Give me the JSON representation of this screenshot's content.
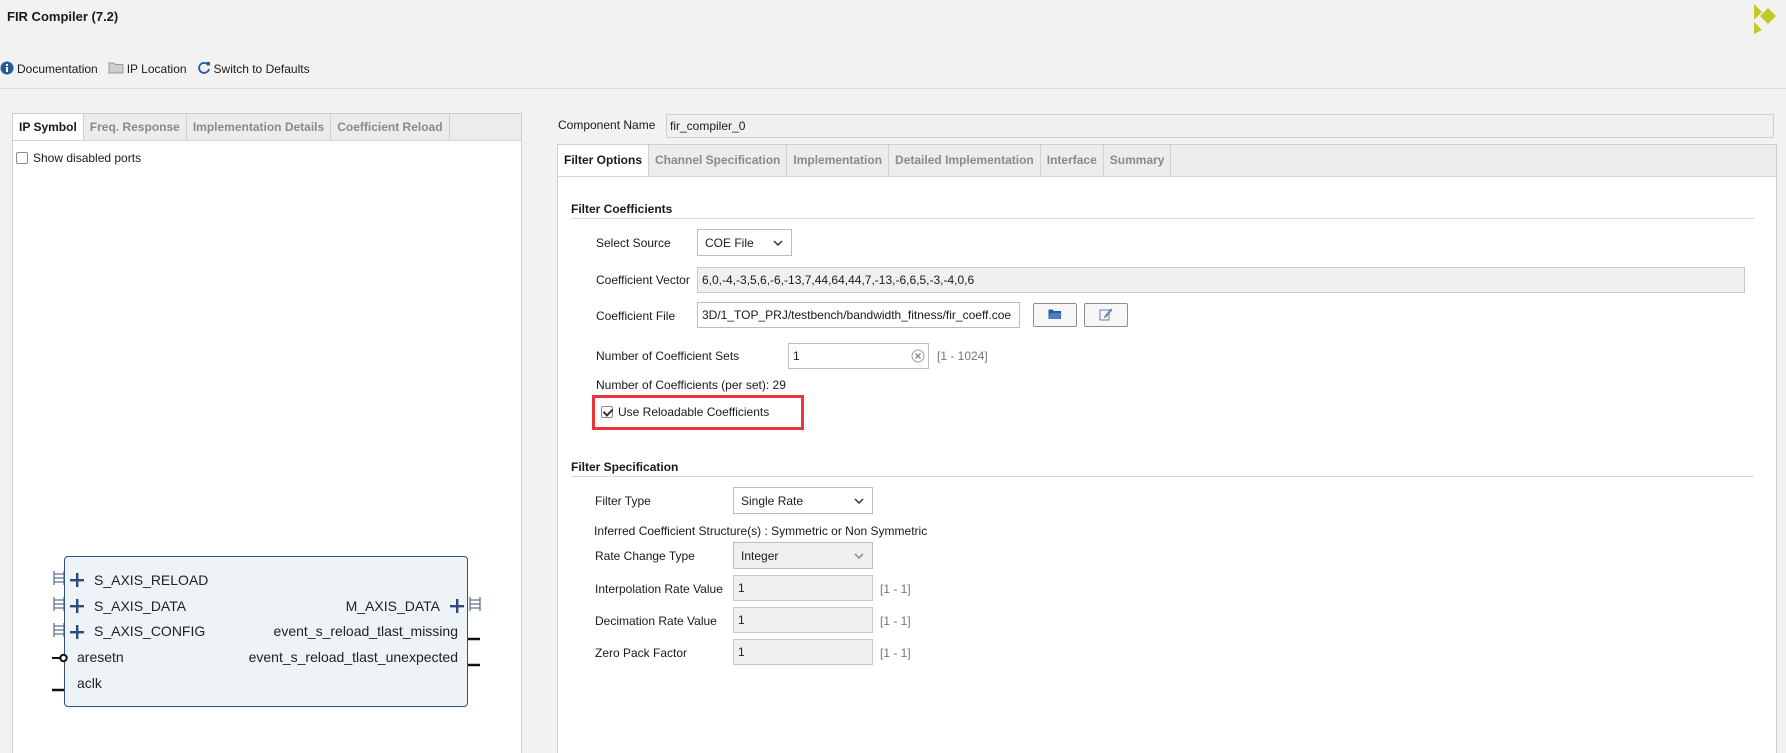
{
  "window": {
    "title": "FIR Compiler (7.2)"
  },
  "toolbar": {
    "documentation": "Documentation",
    "ip_location": "IP Location",
    "switch_defaults": "Switch to Defaults"
  },
  "left_panel": {
    "tabs": [
      "IP Symbol",
      "Freq. Response",
      "Implementation Details",
      "Coefficient Reload"
    ],
    "show_disabled_ports": "Show disabled ports",
    "ports_left": [
      "S_AXIS_RELOAD",
      "S_AXIS_DATA",
      "S_AXIS_CONFIG",
      "aresetn",
      "aclk"
    ],
    "ports_right": [
      "M_AXIS_DATA",
      "event_s_reload_tlast_missing",
      "event_s_reload_tlast_unexpected"
    ]
  },
  "component": {
    "label": "Component Name",
    "value": "fir_compiler_0"
  },
  "right_panel": {
    "tabs": [
      "Filter Options",
      "Channel Specification",
      "Implementation",
      "Detailed Implementation",
      "Interface",
      "Summary"
    ]
  },
  "filter_coefficients": {
    "title": "Filter Coefficients",
    "select_source_label": "Select Source",
    "select_source_value": "COE File",
    "coeff_vector_label": "Coefficient Vector",
    "coeff_vector_value": "6,0,-4,-3,5,6,-6,-13,7,44,64,44,7,-13,-6,6,5,-3,-4,0,6",
    "coeff_file_label": "Coefficient File",
    "coeff_file_value": "3D/1_TOP_PRJ/testbench/bandwidth_fitness/fir_coeff.coe",
    "num_sets_label": "Number of Coefficient Sets",
    "num_sets_value": "1",
    "num_sets_range": "[1 - 1024]",
    "num_coeffs_text": "Number of Coefficients (per set): 29",
    "reloadable_label": "Use Reloadable Coefficients",
    "reloadable_checked": true
  },
  "filter_specification": {
    "title": "Filter Specification",
    "filter_type_label": "Filter Type",
    "filter_type_value": "Single Rate",
    "inferred_text": "Inferred Coefficient Structure(s) : Symmetric or Non Symmetric",
    "rate_change_label": "Rate Change Type",
    "rate_change_value": "Integer",
    "interp_label": "Interpolation Rate Value",
    "interp_value": "1",
    "interp_range": "[1 - 1]",
    "decim_label": "Decimation Rate Value",
    "decim_value": "1",
    "decim_range": "[1 - 1]",
    "zero_pack_label": "Zero Pack Factor",
    "zero_pack_value": "1",
    "zero_pack_range": "[1 - 1]"
  },
  "colors": {
    "highlight": "#e8373c",
    "symbol_border": "#35507a",
    "logo": "#c5c928"
  }
}
